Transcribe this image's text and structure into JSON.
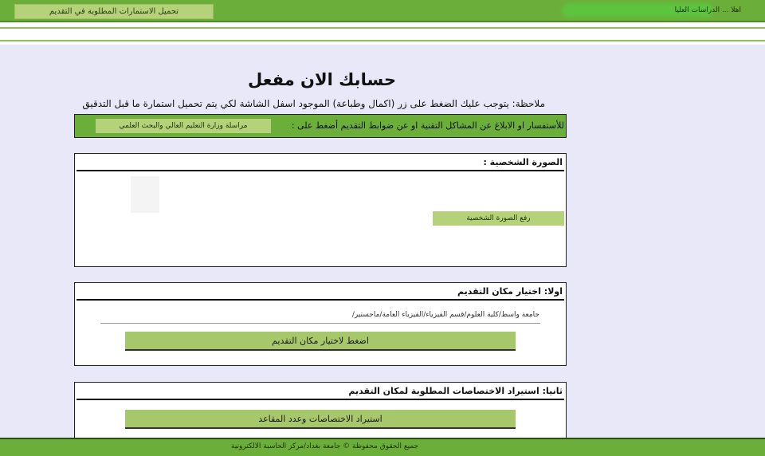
{
  "header": {
    "download_forms_label": "تحميل الاستمارات المطلوبة في التقديم",
    "top_right_text": "اهلا ... الدراسات العليا"
  },
  "main": {
    "title": "حسابك الان مفعل",
    "note": "ملاحظة: يتوجب عليك الضغط على زر (اكمال وطباعة) الموجود اسفل الشاشة لكي يتم تحميل استمارة ما قبل التدقيق",
    "contact_text": "للأستفسار او الابلاغ عن المشاكل التقنية او عن ضوابط التقديم أضغط على :",
    "contact_button": "مراسلة وزارة التعليم العالي والبحث العلمي"
  },
  "photo_panel": {
    "title": "الصورة الشخصية :",
    "upload_button": "رفع الصورة الشخصية"
  },
  "place_panel": {
    "title": "اولا: اختيار مكان التقديم",
    "selected_value": "جامعة واسط/كلية العلوم/قسم الفيزياء/الفيزياء العامة/ماجستير/",
    "choose_button": "اضغط لاختيار مكان التقديم"
  },
  "specialties_panel": {
    "title": "ثانيا: استيراد الاختصاصات المطلوبة لمكان التقديم",
    "import_button": "استيراد الاختصاصات وعدد المقاعد"
  },
  "footer": {
    "text": "جميع الحقوق محفوظة © جامعة بغداد/مركز الحاسبة الالكترونية"
  },
  "colors": {
    "primary_green": "#6cae3a",
    "button_green": "#b5d27a",
    "page_background": "#e8e8f8"
  }
}
